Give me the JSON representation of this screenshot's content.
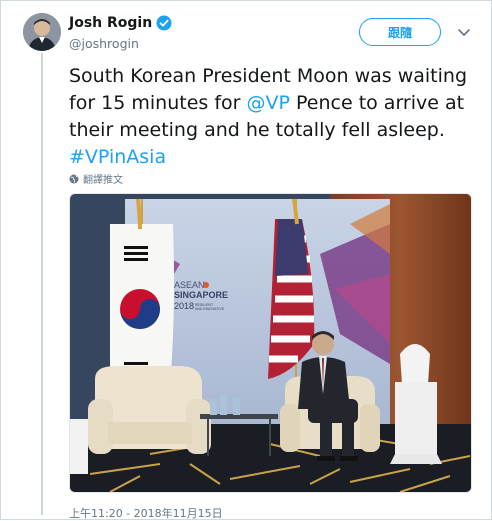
{
  "author": {
    "display_name": "Josh Rogin",
    "handle": "@joshrogin",
    "verified": true
  },
  "actions": {
    "follow_label": "跟隨",
    "menu_icon": "chevron-down-icon"
  },
  "tweet": {
    "text_part1": "South Korean President Moon was waiting for 15 minutes for ",
    "mention": "@VP",
    "text_part2": " Pence to arrive at their meeting and he totally fell asleep. ",
    "hashtag": "#VPinAsia",
    "translate_label": "翻譯推文",
    "timestamp": "上午11:20 - 2018年11月15日"
  },
  "photo": {
    "banner_line1": "ASEAN",
    "banner_line2": "SINGAPORE",
    "banner_year": "2018",
    "banner_tagline1": "RESILIENT",
    "banner_tagline2": "AND INNOVATIVE"
  },
  "colors": {
    "accent": "#1da1f2",
    "text": "#14171a",
    "muted": "#657786"
  }
}
